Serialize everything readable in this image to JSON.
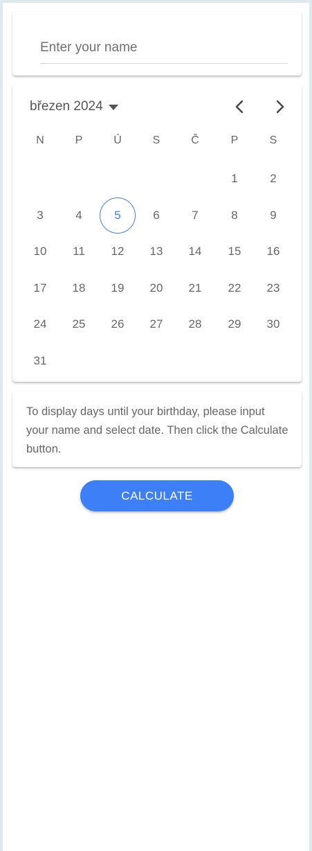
{
  "name_input": {
    "placeholder": "Enter your name",
    "value": ""
  },
  "calendar": {
    "month_label": "březen 2024",
    "weekdays": [
      "N",
      "P",
      "Ú",
      "S",
      "Č",
      "P",
      "S"
    ],
    "first_weekday_index": 5,
    "days_in_month": 31,
    "selected_day": 5
  },
  "info": {
    "text": "To display days until your birthday, please input your name and select date. Then click the Calculate button."
  },
  "calculate_button": {
    "label": "CALCULATE"
  },
  "colors": {
    "accent": "#3d7ff7",
    "selected_ring": "#3f7fe6"
  }
}
